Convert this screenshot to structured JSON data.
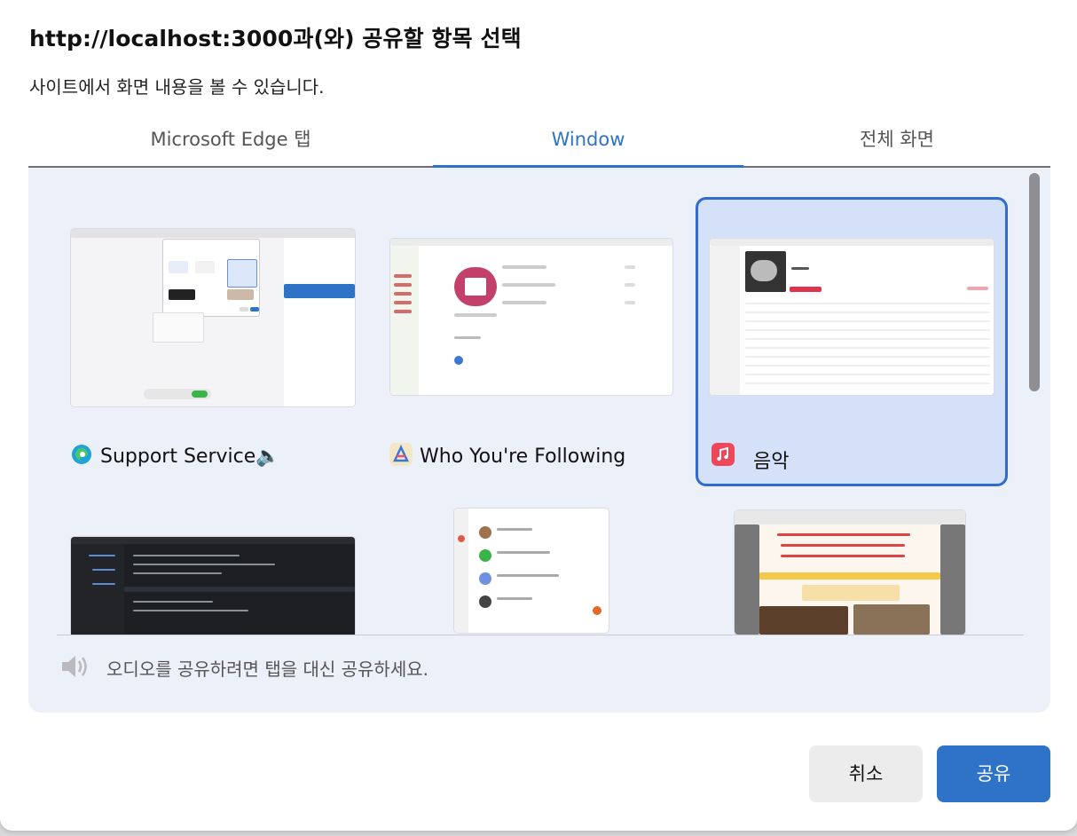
{
  "dialog": {
    "title": "http://localhost:3000과(와) 공유할 항목 선택",
    "subtitle": "사이트에서 화면 내용을 볼 수 있습니다."
  },
  "tabs": [
    {
      "label": "Microsoft Edge 탭",
      "selected": false
    },
    {
      "label": "Window",
      "selected": true
    },
    {
      "label": "전체 화면",
      "selected": false
    }
  ],
  "windows": [
    {
      "label": "Support Service🔈",
      "icon": "edge-icon",
      "selected": false
    },
    {
      "label": "Who You're Following",
      "icon": "app-icon",
      "selected": false
    },
    {
      "label": "음악",
      "icon": "music-icon",
      "selected": true
    }
  ],
  "audio_notice": "오디오를 공유하려면 탭을 대신 공유하세요.",
  "buttons": {
    "cancel": "취소",
    "share": "공유"
  },
  "colors": {
    "accent": "#2f73c9",
    "selected_bg": "#d4e1f9",
    "panel_bg": "#ecf0f8"
  }
}
